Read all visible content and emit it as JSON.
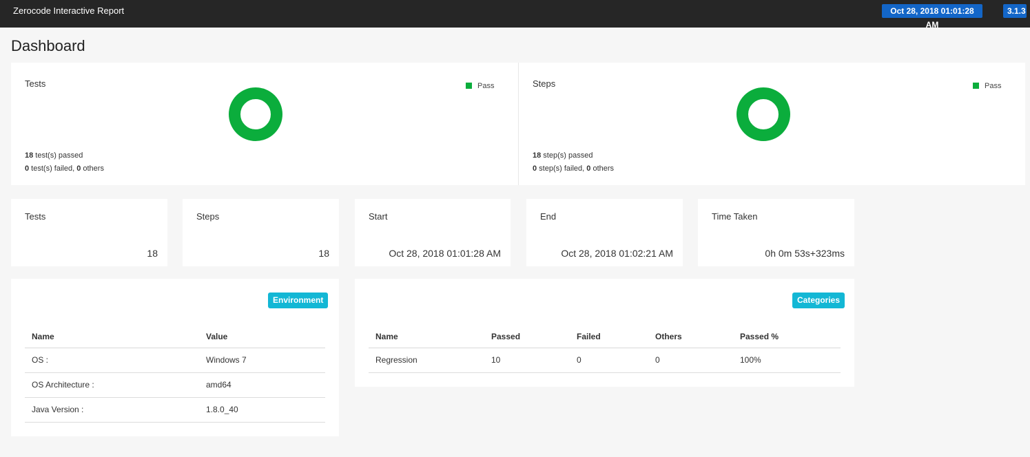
{
  "header": {
    "title": "Zerocode Interactive Report",
    "timestamp": "Oct 28, 2018 01:01:28 AM",
    "version": "3.1.3"
  },
  "page_title": "Dashboard",
  "charts": {
    "tests": {
      "title": "Tests",
      "legend": "Pass",
      "passed_count": "18",
      "passed_text": " test(s) passed",
      "failed_count": "0",
      "failed_text": " test(s) failed, ",
      "others_count": "0",
      "others_text": " others"
    },
    "steps": {
      "title": "Steps",
      "legend": "Pass",
      "passed_count": "18",
      "passed_text": " step(s) passed",
      "failed_count": "0",
      "failed_text": " step(s) failed, ",
      "others_count": "0",
      "others_text": " others"
    }
  },
  "chart_data": [
    {
      "type": "pie",
      "categories": [
        "Pass"
      ],
      "values": [
        18
      ],
      "title": "Tests",
      "legend": "top-right"
    },
    {
      "type": "pie",
      "categories": [
        "Pass"
      ],
      "values": [
        18
      ],
      "title": "Steps",
      "legend": "top-right"
    }
  ],
  "stats": {
    "tests": {
      "label": "Tests",
      "value": "18"
    },
    "steps": {
      "label": "Steps",
      "value": "18"
    },
    "start": {
      "label": "Start",
      "value": "Oct 28, 2018 01:01:28 AM"
    },
    "end": {
      "label": "End",
      "value": "Oct 28, 2018 01:02:21 AM"
    },
    "time": {
      "label": "Time Taken",
      "value": "0h 0m 53s+323ms"
    }
  },
  "environment": {
    "badge": "Environment",
    "columns": [
      "Name",
      "Value"
    ],
    "rows": [
      [
        "OS :",
        "Windows 7"
      ],
      [
        "OS Architecture :",
        "amd64"
      ],
      [
        "Java Version :",
        "1.8.0_40"
      ]
    ]
  },
  "categories": {
    "badge": "Categories",
    "columns": [
      "Name",
      "Passed",
      "Failed",
      "Others",
      "Passed %"
    ],
    "rows": [
      [
        "Regression",
        "10",
        "0",
        "0",
        "100%"
      ]
    ]
  },
  "colors": {
    "pass": "#0bad3c",
    "header_bg": "#262626",
    "badge_blue": "#1366c8",
    "badge_teal": "#13b7d5"
  }
}
